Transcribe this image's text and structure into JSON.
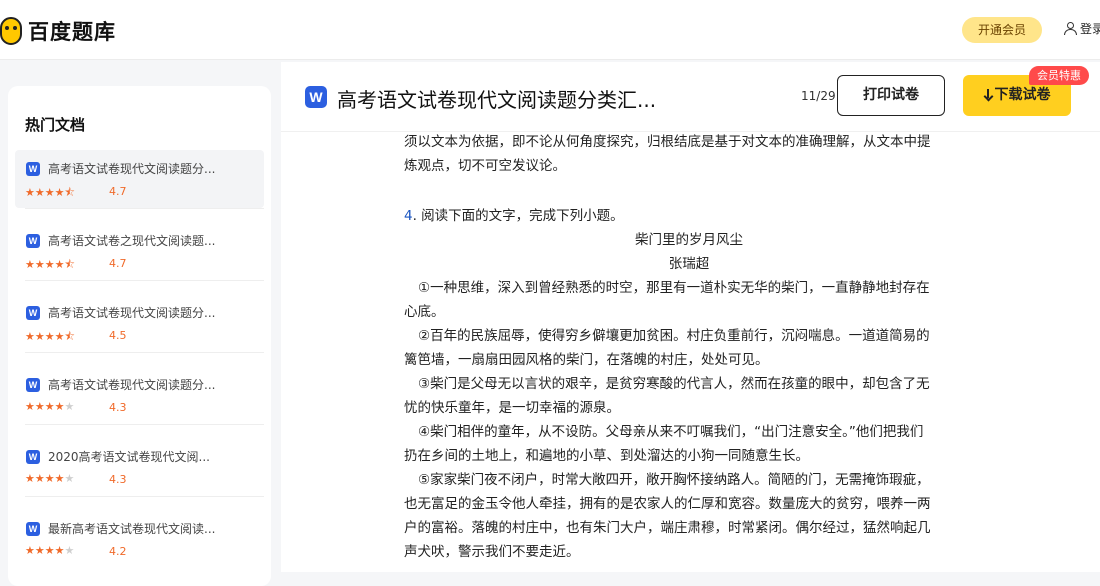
{
  "header": {
    "logo_text": "百度题库",
    "vip_button": "开通会员",
    "login": "登录"
  },
  "sidebar": {
    "title": "热门文档",
    "items": [
      {
        "name": "高考语文试卷现代文阅读题分...",
        "score": "4.7",
        "stars": 4.5,
        "active": true
      },
      {
        "name": "高考语文试卷之现代文阅读题...",
        "score": "4.7",
        "stars": 4.5,
        "active": false
      },
      {
        "name": "高考语文试卷现代文阅读题分...",
        "score": "4.5",
        "stars": 4.5,
        "active": false
      },
      {
        "name": "高考语文试卷现代文阅读题分...",
        "score": "4.3",
        "stars": 4,
        "active": false
      },
      {
        "name": "2020高考语文试卷现代文阅...",
        "score": "4.3",
        "stars": 4,
        "active": false
      },
      {
        "name": "最新高考语文试卷现代文阅读...",
        "score": "4.2",
        "stars": 4,
        "active": false
      }
    ]
  },
  "document": {
    "title": "高考语文试卷现代文阅读题分类汇...",
    "page_indicator": "11/29",
    "print_button": "打印试卷",
    "download_button": "下载试卷",
    "vip_badge": "会员特惠",
    "lines": [
      "须以文本为依据，即不论从何角度探究，归根结底是基于对文本的准确理解，从文本中提",
      "炼观点，切不可空发议论。"
    ],
    "question_number": "4",
    "question_text": ". 阅读下面的文字，完成下列小题。",
    "essay_title": "柴门里的岁月风尘",
    "essay_author": "张瑞超",
    "paragraphs": [
      [
        "①一种思维，深入到曾经熟悉的时空，那里有一道朴实无华的柴门，一直静静地封存在",
        "心底。"
      ],
      [
        "②百年的民族屈辱，使得穷乡僻壤更加贫困。村庄负重前行，沉闷喘息。一道道简易的",
        "篱笆墙，一扇扇田园风格的柴门，在落魄的村庄，处处可见。"
      ],
      [
        "③柴门是父母无以言状的艰辛，是贫穷寒酸的代言人，然而在孩童的眼中，却包含了无",
        "忧的快乐童年，是一切幸福的源泉。"
      ],
      [
        "④柴门相伴的童年，从不设防。父母亲从来不叮嘱我们，“出门注意安全。”他们把我们",
        "扔在乡间的土地上，和遍地的小草、到处溜达的小狗一同随意生长。"
      ],
      [
        "⑤家家柴门夜不闭户，时常大敞四开，敞开胸怀接纳路人。简陋的门，无需掩饰瑕疵，",
        "也无富足的金玉令他人牵挂，拥有的是农家人的仁厚和宽容。数量庞大的贫穷，喂养一两",
        "户的富裕。落魄的村庄中，也有朱门大户，端庄肃穆，时常紧闭。偶尔经过，猛然响起几",
        "声犬吠，警示我们不要走近。"
      ]
    ]
  },
  "colors": {
    "accent_yellow": "#ffcf1f",
    "word_blue": "#2c5fe0",
    "star_orange": "#f06a2a",
    "badge_red": "#ff4a4a"
  }
}
